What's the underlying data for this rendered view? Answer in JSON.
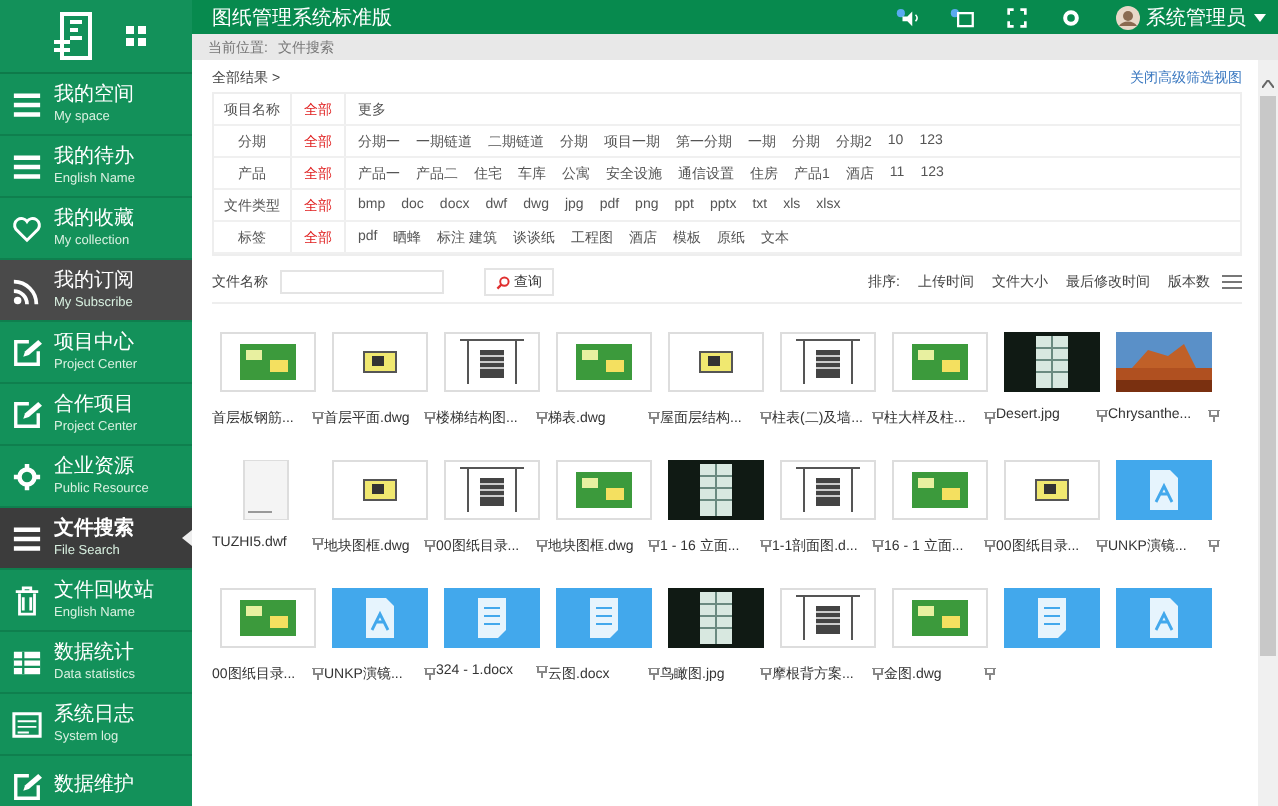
{
  "app": {
    "title": "图纸管理系统标准版",
    "user": "系统管理员"
  },
  "sidebar": {
    "items": [
      {
        "label": "我的空间",
        "sub": "My space",
        "selected": false,
        "hovered": false
      },
      {
        "label": "我的待办",
        "sub": "English Name",
        "selected": false,
        "hovered": false
      },
      {
        "label": "我的收藏",
        "sub": "My collection",
        "selected": false,
        "hovered": false
      },
      {
        "label": "我的订阅",
        "sub": "My Subscribe",
        "selected": false,
        "hovered": true
      },
      {
        "label": "项目中心",
        "sub": "Project Center",
        "selected": false,
        "hovered": false
      },
      {
        "label": "合作项目",
        "sub": "Project Center",
        "selected": false,
        "hovered": false
      },
      {
        "label": "企业资源",
        "sub": "Public Resource",
        "selected": false,
        "hovered": false
      },
      {
        "label": "文件搜索",
        "sub": "File Search",
        "selected": true,
        "hovered": false
      },
      {
        "label": "文件回收站",
        "sub": "English Name",
        "selected": false,
        "hovered": false
      },
      {
        "label": "数据统计",
        "sub": "Data statistics",
        "selected": false,
        "hovered": false
      },
      {
        "label": "系统日志",
        "sub": "System log",
        "selected": false,
        "hovered": false
      },
      {
        "label": "数据维护",
        "selected": false,
        "hovered": false
      }
    ]
  },
  "breadcrumb": {
    "label": "当前位置:",
    "current": "文件搜索"
  },
  "filters": {
    "crumb": "全部结果 >",
    "view_link": "关闭高级筛选视图",
    "rows": [
      {
        "label": "项目名称",
        "options": [
          {
            "text": "全部",
            "selected": true
          },
          {
            "text": "更多",
            "selected": false
          }
        ]
      },
      {
        "label": "分期",
        "options": [
          {
            "text": "全部",
            "selected": true
          },
          {
            "text": "分期一",
            "selected": false
          },
          {
            "text": "一期链道",
            "selected": false
          },
          {
            "text": "二期链道",
            "selected": false
          },
          {
            "text": "分期",
            "selected": false
          },
          {
            "text": "项目一期",
            "selected": false
          },
          {
            "text": "第一分期",
            "selected": false
          },
          {
            "text": "一期",
            "selected": false
          },
          {
            "text": "分期",
            "selected": false
          },
          {
            "text": "分期2",
            "selected": false
          },
          {
            "text": "10",
            "selected": false
          },
          {
            "text": "123",
            "selected": false
          }
        ]
      },
      {
        "label": "产品",
        "options": [
          {
            "text": "全部",
            "selected": true
          },
          {
            "text": "产品一",
            "selected": false
          },
          {
            "text": "产品二",
            "selected": false
          },
          {
            "text": "住宅",
            "selected": false
          },
          {
            "text": "车库",
            "selected": false
          },
          {
            "text": "公寓",
            "selected": false
          },
          {
            "text": "安全设施",
            "selected": false
          },
          {
            "text": "通信设置",
            "selected": false
          },
          {
            "text": "住房",
            "selected": false
          },
          {
            "text": "产品1",
            "selected": false
          },
          {
            "text": "酒店",
            "selected": false
          },
          {
            "text": "11",
            "selected": false
          },
          {
            "text": "123",
            "selected": false
          }
        ]
      },
      {
        "label": "文件类型",
        "options": [
          {
            "text": "全部",
            "selected": true
          },
          {
            "text": "bmp",
            "selected": false
          },
          {
            "text": "doc",
            "selected": false
          },
          {
            "text": "docx",
            "selected": false
          },
          {
            "text": "dwf",
            "selected": false
          },
          {
            "text": "dwg",
            "selected": false
          },
          {
            "text": "jpg",
            "selected": false
          },
          {
            "text": "pdf",
            "selected": false
          },
          {
            "text": "png",
            "selected": false
          },
          {
            "text": "ppt",
            "selected": false
          },
          {
            "text": "pptx",
            "selected": false
          },
          {
            "text": "txt",
            "selected": false
          },
          {
            "text": "xls",
            "selected": false
          },
          {
            "text": "xlsx",
            "selected": false
          }
        ]
      },
      {
        "label": "标签",
        "options": [
          {
            "text": "全部",
            "selected": true
          },
          {
            "text": "pdf",
            "selected": false
          },
          {
            "text": "晒蜂",
            "selected": false
          },
          {
            "text": "标注 建筑",
            "selected": false
          },
          {
            "text": "谈谈纸",
            "selected": false
          },
          {
            "text": "工程图",
            "selected": false
          },
          {
            "text": "酒店",
            "selected": false
          },
          {
            "text": "模板",
            "selected": false
          },
          {
            "text": "原纸",
            "selected": false
          },
          {
            "text": "文本",
            "selected": false
          }
        ]
      }
    ]
  },
  "search": {
    "label": "文件名称",
    "button": "查询",
    "sort_label": "排序:",
    "sort_options": [
      "上传时间",
      "文件大小",
      "最后修改时间",
      "版本数"
    ]
  },
  "files": [
    {
      "name": "首层板钢筋...",
      "kind": "cad"
    },
    {
      "name": "首层平面.dwg",
      "kind": "cad"
    },
    {
      "name": "楼梯结构图...",
      "kind": "cad"
    },
    {
      "name": "梯表.dwg",
      "kind": "cad"
    },
    {
      "name": "屋面层结构...",
      "kind": "cad"
    },
    {
      "name": "柱表(二)及墙...",
      "kind": "cad"
    },
    {
      "name": "柱大样及柱...",
      "kind": "cad"
    },
    {
      "name": "Desert.jpg",
      "kind": "picture"
    },
    {
      "name": "Chrysanthe...",
      "kind": "picture"
    },
    {
      "name": "TUZHI5.dwf",
      "kind": "blank"
    },
    {
      "name": "地块图框.dwg",
      "kind": "cad"
    },
    {
      "name": "00图纸目录...",
      "kind": "cad"
    },
    {
      "name": "地块图框.dwg",
      "kind": "cad"
    },
    {
      "name": "1 - 16 立面...",
      "kind": "picture"
    },
    {
      "name": "1-1剖面图.d...",
      "kind": "cad"
    },
    {
      "name": "16 - 1 立面...",
      "kind": "cad"
    },
    {
      "name": "00图纸目录...",
      "kind": "cad"
    },
    {
      "name": "UNKP演镜...",
      "kind": "pdf"
    },
    {
      "name": "00图纸目录...",
      "kind": "cad"
    },
    {
      "name": "UNKP演镜...",
      "kind": "pdf"
    },
    {
      "name": "324 - 1.docx",
      "kind": "doc"
    },
    {
      "name": "云图.docx",
      "kind": "doc"
    },
    {
      "name": "鸟瞰图.jpg",
      "kind": "picture"
    },
    {
      "name": "摩根背方案...",
      "kind": "cad"
    },
    {
      "name": "金图.dwg",
      "kind": "cad"
    },
    {
      "kind": "doc"
    },
    {
      "kind": "pdf"
    }
  ]
}
